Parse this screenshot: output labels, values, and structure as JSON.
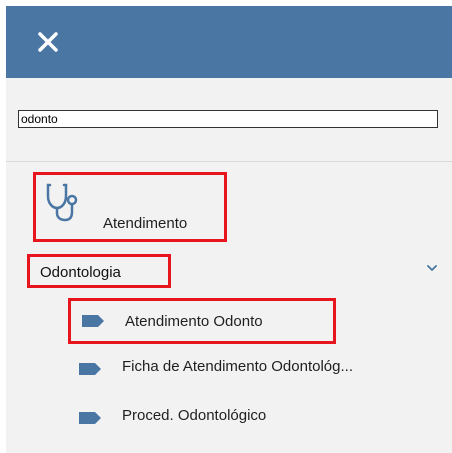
{
  "header": {
    "close_icon": "close-icon",
    "bg_color": "#4a76a3"
  },
  "search": {
    "value": "odonto"
  },
  "module": {
    "label": "Atendimento",
    "icon": "stethoscope-icon"
  },
  "group": {
    "label": "Odontologia",
    "expanded": true,
    "icon": "chevron-down-icon"
  },
  "items": [
    {
      "label": "Atendimento Odonto",
      "icon": "tag-icon",
      "highlighted": true
    },
    {
      "label": "Ficha de Atendimento Odontológ...",
      "icon": "tag-icon",
      "highlighted": false
    },
    {
      "label": "Proced. Odontológico",
      "icon": "tag-icon",
      "highlighted": false
    }
  ],
  "colors": {
    "highlight": "#e8141e",
    "item_icon": "#4a76a3"
  }
}
